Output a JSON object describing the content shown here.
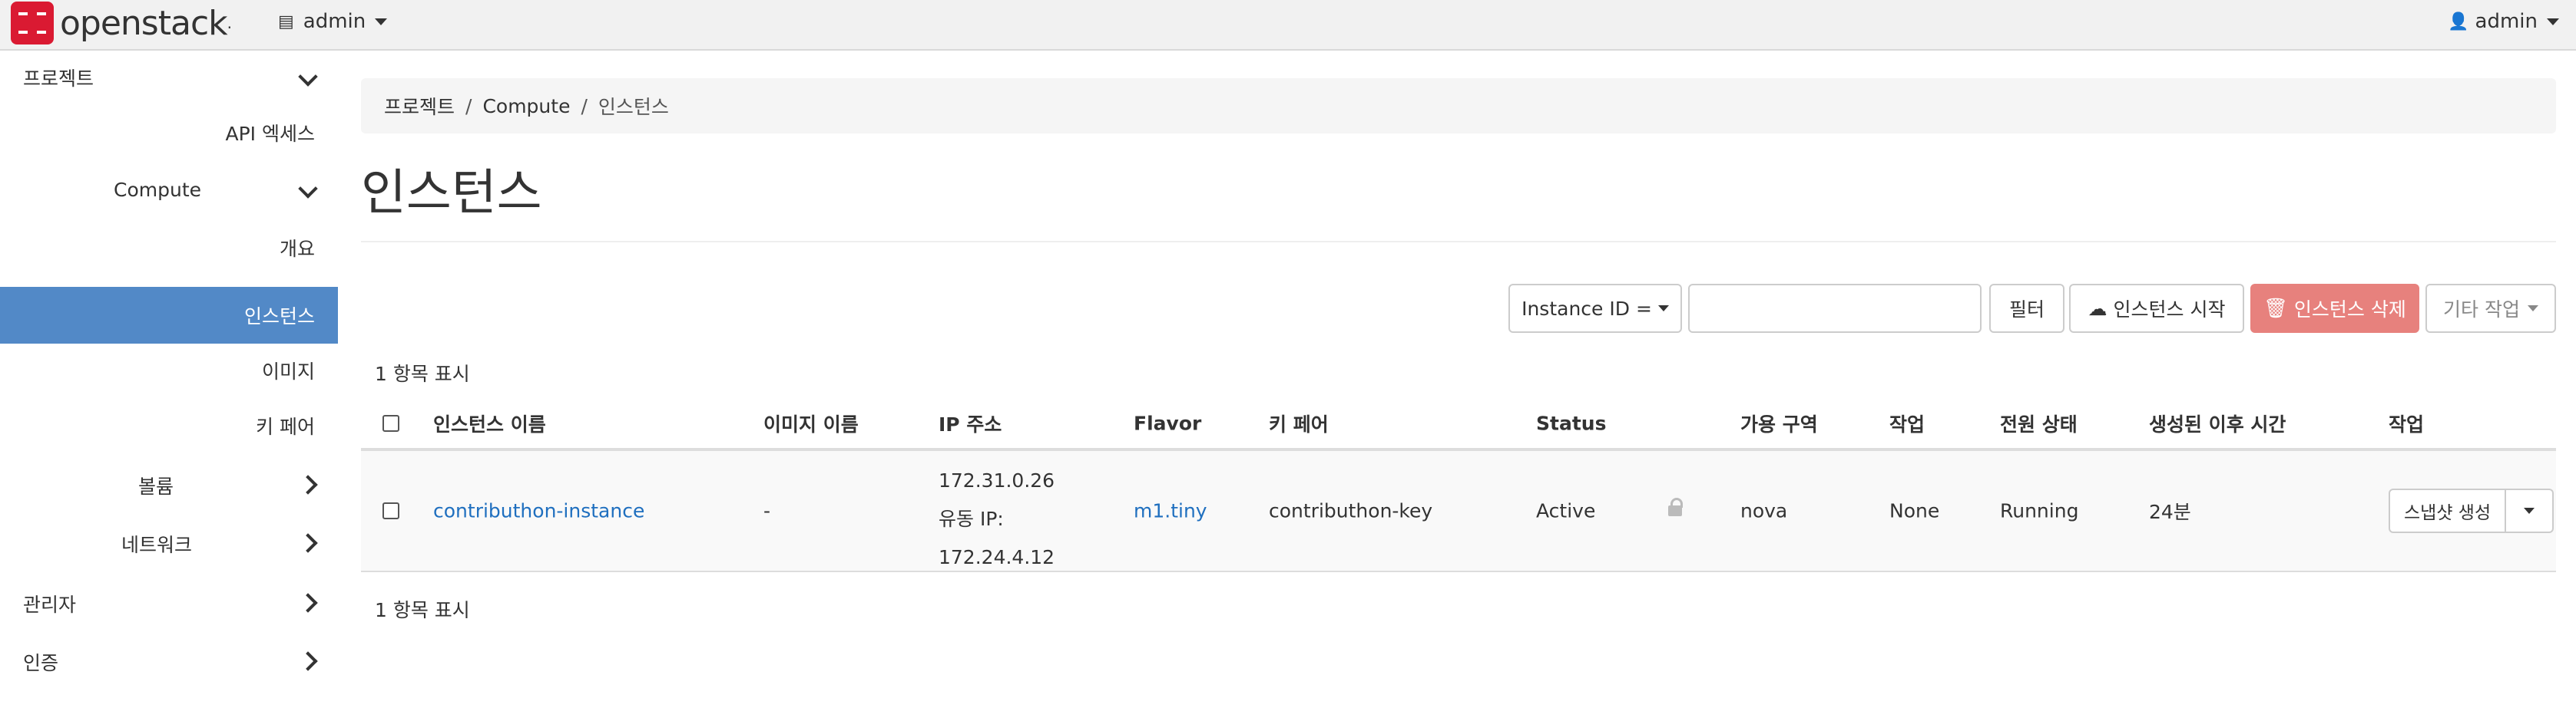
{
  "navbar": {
    "logo_text": "openstack",
    "project": "admin",
    "user": "admin"
  },
  "sidebar": {
    "project": "프로젝트",
    "api_access": "API 엑세스",
    "compute": "Compute",
    "overview": "개요",
    "instances": "인스턴스",
    "images": "이미지",
    "key_pairs": "키 페어",
    "volumes": "볼륨",
    "network": "네트워크",
    "admin": "관리자",
    "identity": "인증"
  },
  "breadcrumb": [
    "프로젝트",
    "Compute",
    "인스턴스"
  ],
  "page": {
    "title": "인스턴스"
  },
  "toolbar": {
    "filter_select": "Instance ID =",
    "filter_placeholder": "",
    "filter_button": "필터",
    "launch_button": "인스턴스 시작",
    "delete_button": "인스턴스 삭제",
    "more_button": "기타 작업"
  },
  "count_top": "1 항목 표시",
  "count_bottom": "1 항목 표시",
  "table": {
    "headers": [
      "인스턴스 이름",
      "이미지 이름",
      "IP 주소",
      "Flavor",
      "키 페어",
      "Status",
      "가용 구역",
      "작업",
      "전원 상태",
      "생성된 이후 시간",
      "작업"
    ],
    "rows": [
      {
        "name": "contributhon-instance",
        "image": "-",
        "ip1": "172.31.0.26",
        "ip_floating_label": "유동 IP:",
        "ip2": "172.24.4.12",
        "flavor": "m1.tiny",
        "key_pair": "contributhon-key",
        "status": "Active",
        "az": "nova",
        "task": "None",
        "power": "Running",
        "age": "24분",
        "action": "스냅샷 생성"
      }
    ]
  }
}
